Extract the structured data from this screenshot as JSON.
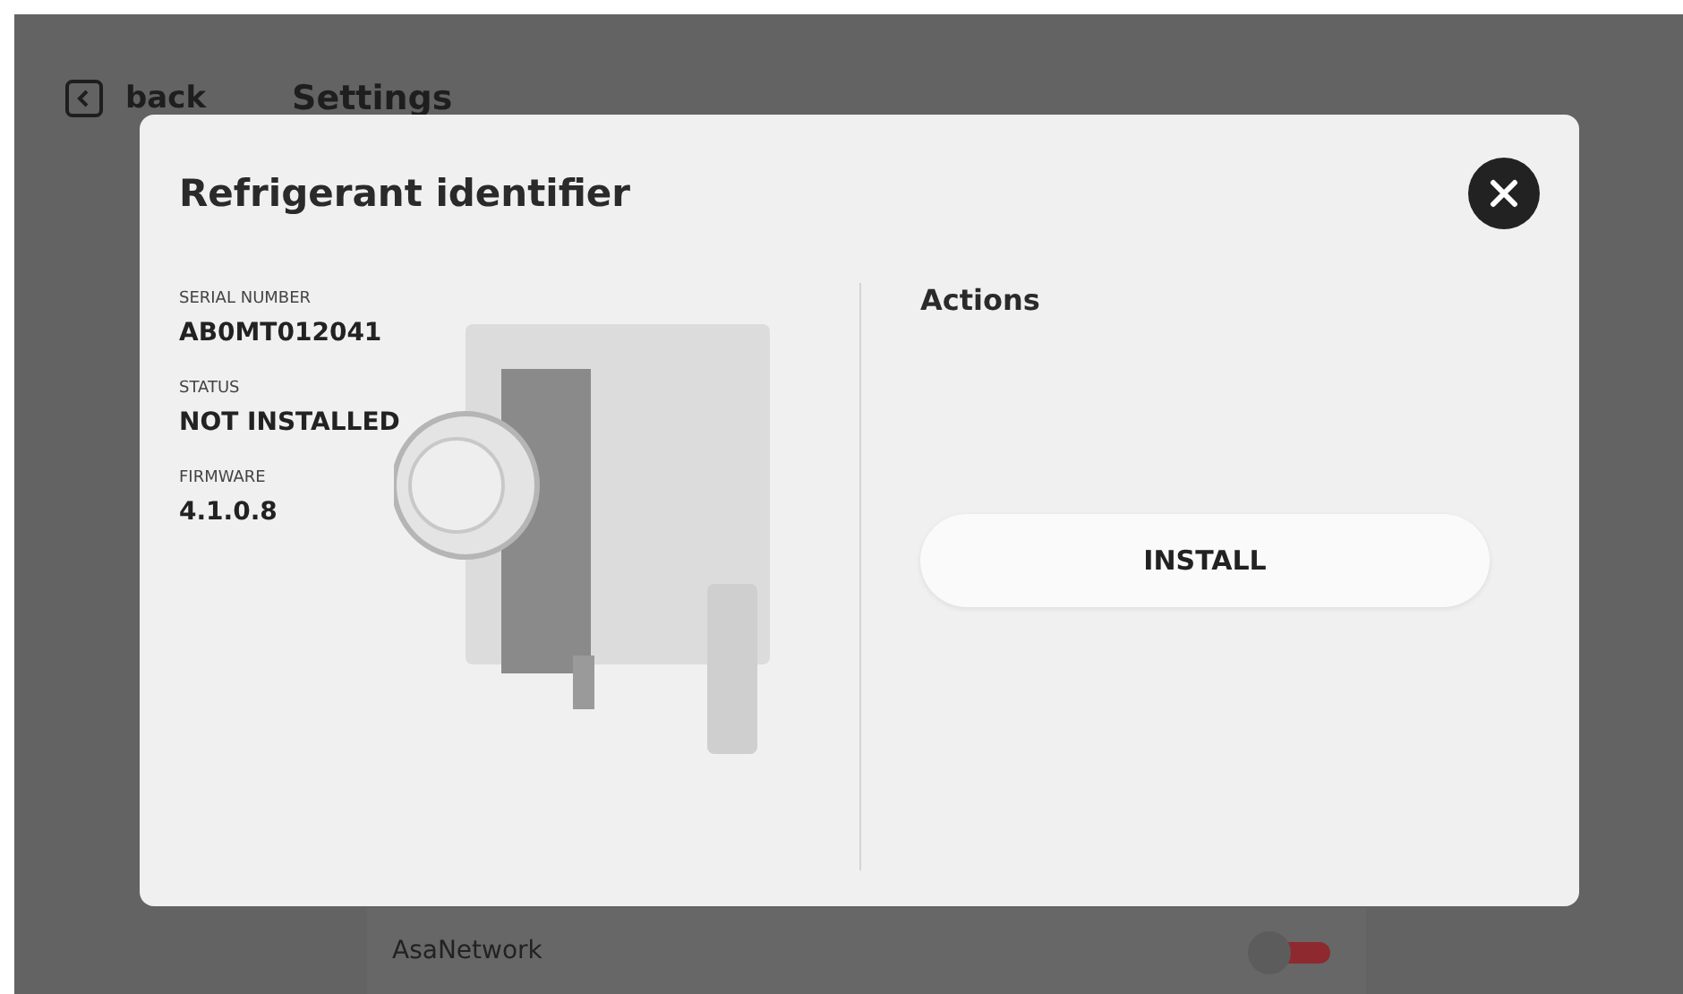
{
  "header": {
    "back_label": "back",
    "title": "Settings"
  },
  "list_rows": [
    {
      "label": "AsaNetwork",
      "on": false
    }
  ],
  "dialog": {
    "title": "Refrigerant identifier",
    "details": [
      {
        "label": "SERIAL NUMBER",
        "value": "AB0MT012041"
      },
      {
        "label": "STATUS",
        "value": "NOT INSTALLED"
      },
      {
        "label": "FIRMWARE",
        "value": "4.1.0.8"
      }
    ],
    "actions_title": "Actions",
    "buttons": [
      "INSTALL"
    ]
  }
}
